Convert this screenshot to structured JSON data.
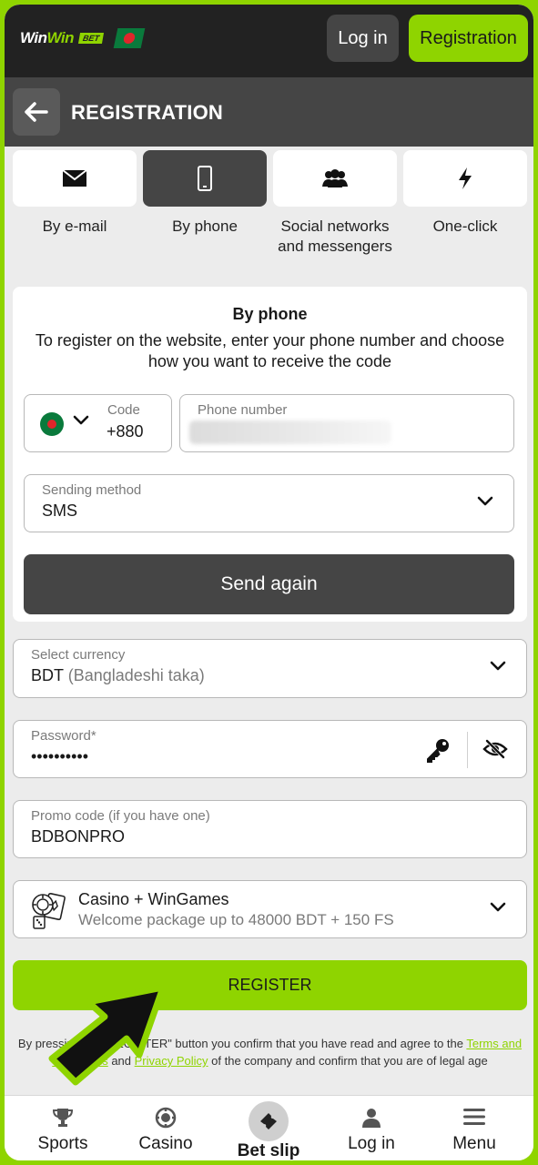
{
  "header": {
    "logo_win1": "Win",
    "logo_win2": "Win",
    "logo_bet": "BET",
    "login_label": "Log in",
    "register_label": "Registration"
  },
  "page": {
    "title": "REGISTRATION"
  },
  "tabs": [
    {
      "label": "By e-mail",
      "icon": "envelope-icon",
      "active": false
    },
    {
      "label": "By phone",
      "icon": "phone-icon",
      "active": true
    },
    {
      "label": "Social networks and messengers",
      "icon": "users-icon",
      "active": false
    },
    {
      "label": "One-click",
      "icon": "lightning-icon",
      "active": false
    }
  ],
  "card": {
    "title": "By phone",
    "description": "To register on the website, enter your phone number and choose how you want to receive the code",
    "code_label": "Code",
    "code_value": "+880",
    "phone_label": "Phone number",
    "method_label": "Sending method",
    "method_value": "SMS",
    "send_again": "Send again"
  },
  "currency": {
    "label": "Select currency",
    "code": "BDT",
    "name": "(Bangladeshi taka)"
  },
  "password": {
    "label": "Password*",
    "value": "••••••••••"
  },
  "promo": {
    "label": "Promo code (if you have one)",
    "value": "BDBONPRO"
  },
  "bonus": {
    "title": "Casino + WinGames",
    "subtitle": "Welcome package up to 48000 BDT + 150 FS"
  },
  "register_button": "REGISTER",
  "terms": {
    "prefix": "By pressing the \"REGISTER\" button you confirm that you have read and agree to the ",
    "link1": "Terms and Conditions",
    "middle": " and ",
    "link2": "Privacy Policy",
    "suffix": " of the company and confirm that you are of legal age"
  },
  "nav": [
    {
      "label": "Sports",
      "icon": "trophy-icon"
    },
    {
      "label": "Casino",
      "icon": "casino-chip-icon"
    },
    {
      "label": "Bet slip",
      "icon": "ticket-icon",
      "active": true
    },
    {
      "label": "Log in",
      "icon": "user-icon"
    },
    {
      "label": "Menu",
      "icon": "menu-icon"
    }
  ],
  "colors": {
    "accent": "#8fd400",
    "dark": "#222222",
    "panel": "#454545"
  }
}
